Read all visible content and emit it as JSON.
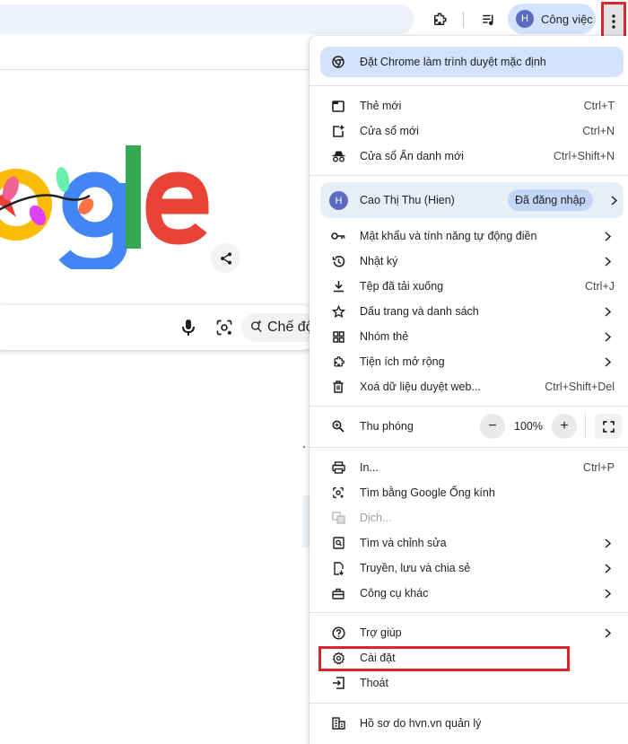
{
  "toolbar": {
    "profile_initial": "H",
    "profile_label": "Công việc",
    "icons": [
      "extension-icon",
      "media-queue-icon",
      "kebab-menu-icon"
    ]
  },
  "page": {
    "search_ai_label": "Chế độ",
    "icons": [
      "share-icon",
      "mic-icon",
      "lens-icon",
      "sparkle-search-icon"
    ]
  },
  "menu": {
    "default_browser": "Đặt Chrome làm trình duyệt mặc định",
    "new_tab": {
      "label": "Thẻ mới",
      "shortcut": "Ctrl+T"
    },
    "new_window": {
      "label": "Cửa sổ mới",
      "shortcut": "Ctrl+N"
    },
    "incognito": {
      "label": "Cửa sổ Ẩn danh mới",
      "shortcut": "Ctrl+Shift+N"
    },
    "profile": {
      "initial": "H",
      "name": "Cao Thị Thu (Hien)",
      "badge": "Đã đăng nhập"
    },
    "passwords": {
      "label": "Mật khẩu và tính năng tự động điền"
    },
    "history": {
      "label": "Nhật ký"
    },
    "downloads": {
      "label": "Tệp đã tải xuống",
      "shortcut": "Ctrl+J"
    },
    "bookmarks": {
      "label": "Dấu trang và danh sách"
    },
    "tab_groups": {
      "label": "Nhóm thẻ"
    },
    "extensions": {
      "label": "Tiện ích mở rộng"
    },
    "clear_data": {
      "label": "Xoá dữ liệu duyệt web...",
      "shortcut": "Ctrl+Shift+Del"
    },
    "zoom": {
      "label": "Thu phóng",
      "value": "100%",
      "minus": "−",
      "plus": "+"
    },
    "print": {
      "label": "In...",
      "shortcut": "Ctrl+P"
    },
    "lens": {
      "label": "Tìm bằng Google Ống kính"
    },
    "translate": {
      "label": "Dịch..."
    },
    "find_edit": {
      "label": "Tìm và chỉnh sửa"
    },
    "cast_save_share": {
      "label": "Truyền, lưu và chia sẻ"
    },
    "more_tools": {
      "label": "Công cụ khác"
    },
    "help": {
      "label": "Trợ giúp"
    },
    "settings": {
      "label": "Cài đặt"
    },
    "exit": {
      "label": "Thoát"
    },
    "managed": {
      "label": "Hồ sơ do hvn.vn quản lý"
    }
  },
  "colors": {
    "highlight_box": "#d7262e",
    "profile_chip_bg": "#d3e3fd",
    "avatar_bg": "#5c6bc0"
  }
}
